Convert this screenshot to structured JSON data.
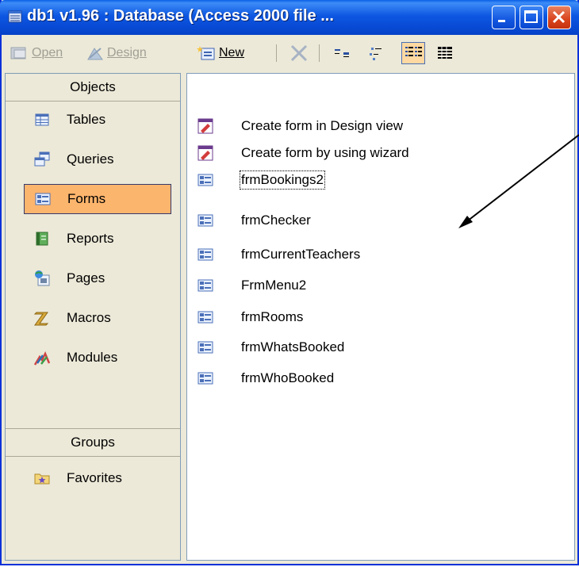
{
  "window": {
    "title": "db1 v1.96 : Database (Access 2000 file ...",
    "icon": "database-window-icon",
    "titlebar_color": "#0849d3"
  },
  "toolbar": {
    "open_label": "Open",
    "design_label": "Design",
    "new_label": "New",
    "delete_icon": "delete-x-icon",
    "view_large_icons": "large-icons-view-icon",
    "view_small_icons": "small-icons-view-icon",
    "view_list": "list-view-icon",
    "view_details": "details-view-icon"
  },
  "objects_pane": {
    "header": "Objects",
    "items": [
      {
        "label": "Tables",
        "icon": "table-icon"
      },
      {
        "label": "Queries",
        "icon": "query-icon"
      },
      {
        "label": "Forms",
        "icon": "form-icon",
        "selected": true
      },
      {
        "label": "Reports",
        "icon": "report-icon"
      },
      {
        "label": "Pages",
        "icon": "page-icon"
      },
      {
        "label": "Macros",
        "icon": "macro-icon"
      },
      {
        "label": "Modules",
        "icon": "module-icon"
      }
    ],
    "groups_header": "Groups",
    "groups": [
      {
        "label": "Favorites",
        "icon": "favorites-folder-icon"
      }
    ],
    "selected_color": "#fcb56d"
  },
  "forms_list": {
    "items": [
      {
        "label": "Create form in Design view",
        "icon": "design-view-shortcut-icon"
      },
      {
        "label": "Create form by using wizard",
        "icon": "wizard-shortcut-icon"
      },
      {
        "label": "frmBookings2",
        "icon": "form-icon",
        "focused": true
      },
      {
        "label": "frmChecker",
        "icon": "form-icon"
      },
      {
        "label": "frmCurrentTeachers",
        "icon": "form-icon"
      },
      {
        "label": "FrmMenu2",
        "icon": "form-icon"
      },
      {
        "label": "frmRooms",
        "icon": "form-icon"
      },
      {
        "label": "frmWhatsBooked",
        "icon": "form-icon"
      },
      {
        "label": "frmWhoBooked",
        "icon": "form-icon"
      }
    ]
  }
}
